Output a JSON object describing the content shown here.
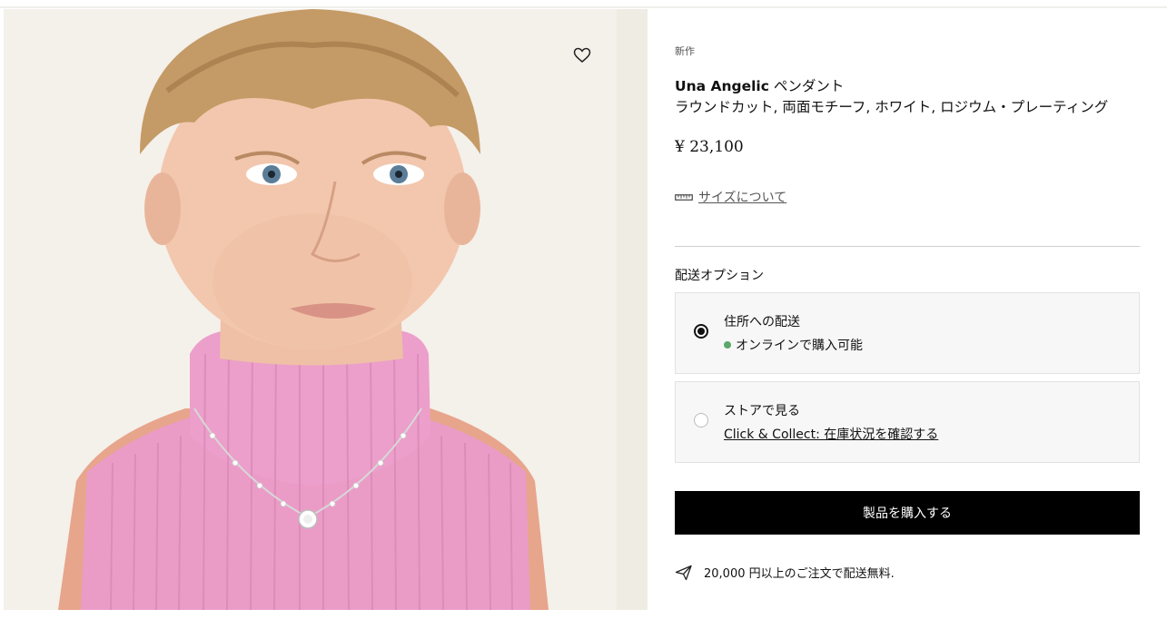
{
  "colors": {
    "button_bg": "#000000",
    "button_text": "#ffffff",
    "availability_dot": "#5aa86a",
    "option_bg": "#f7f7f7",
    "sweater": "#e99ac4"
  },
  "gallery": {
    "wishlist_icon": "heart-outline-icon"
  },
  "product": {
    "badge": "新作",
    "brand": "Una Angelic",
    "name_suffix": " ペンダント",
    "description": "ラウンドカット, 両面モチーフ, ホワイト, ロジウム・プレーティング",
    "price": "¥ 23,100",
    "size_guide_label": "サイズについて",
    "size_guide_icon": "ruler-icon"
  },
  "delivery": {
    "title": "配送オプション",
    "options": [
      {
        "title": "住所への配送",
        "status": "オンラインで購入可能",
        "selected": true
      },
      {
        "title": "ストアで見る",
        "link": "Click & Collect: 在庫状況を確認する",
        "selected": false
      }
    ]
  },
  "actions": {
    "buy_label": "製品を購入する"
  },
  "shipping": {
    "icon": "paper-plane-icon",
    "note": "20,000 円以上のご注文で配送無料."
  }
}
